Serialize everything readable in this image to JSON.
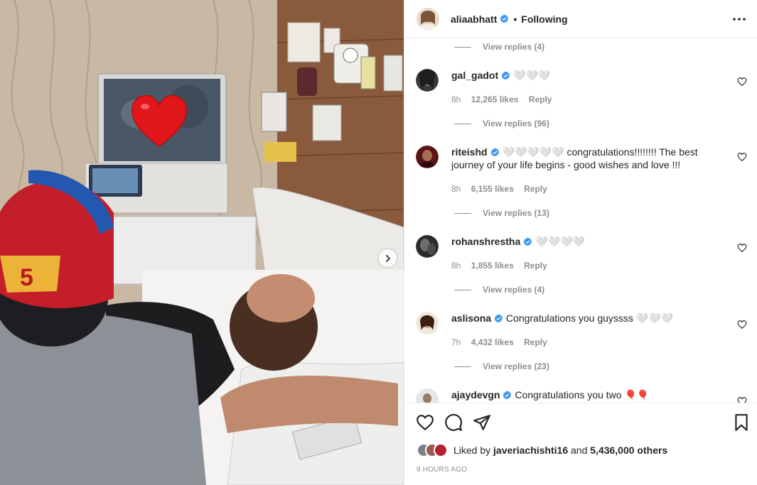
{
  "post": {
    "username": "aliaabhatt",
    "dot": "•",
    "follow_status": "Following",
    "photo_overlay": "heart-emoji"
  },
  "comments": [
    {
      "username": "gal_gadot",
      "verified": true,
      "text": "🤍🤍🤍",
      "time": "8h",
      "likes": "12,265 likes",
      "reply": "Reply",
      "view_replies": "View replies (96)"
    },
    {
      "username": "riteishd",
      "verified": true,
      "text": "🤍🤍🤍🤍🤍 congratulations!!!!!!!! The best journey of your life begins - good wishes and love !!!",
      "time": "8h",
      "likes": "6,155 likes",
      "reply": "Reply",
      "view_replies": "View replies (13)"
    },
    {
      "username": "rohanshrestha",
      "verified": true,
      "text": "🤍🤍🤍🤍",
      "time": "8h",
      "likes": "1,855 likes",
      "reply": "Reply",
      "view_replies": "View replies (4)"
    },
    {
      "username": "aslisona",
      "verified": true,
      "text": "Congratulations you guyssss 🤍🤍🤍",
      "time": "7h",
      "likes": "4,432 likes",
      "reply": "Reply",
      "view_replies": "View replies (23)"
    },
    {
      "username": "ajaydevgn",
      "verified": true,
      "text": "Congratulations you two 🎈🎈",
      "time": "",
      "likes": "",
      "reply": "",
      "view_replies": ""
    }
  ],
  "top_view_replies": "View replies (4)",
  "engagement": {
    "liked_by_prefix": "Liked by",
    "liked_by_user": "javeriachishti16",
    "and": "and",
    "others": "5,436,000 others",
    "time_ago": "9 HOURS AGO"
  },
  "icons": [
    "heart-icon",
    "comment-icon",
    "share-icon",
    "bookmark-icon",
    "more-options-icon",
    "verified-badge-icon",
    "chevron-right-icon"
  ],
  "colors": {
    "verified": "#3897f0",
    "muted": "#8e8e8e",
    "text": "#262626",
    "divider": "#efefef"
  }
}
